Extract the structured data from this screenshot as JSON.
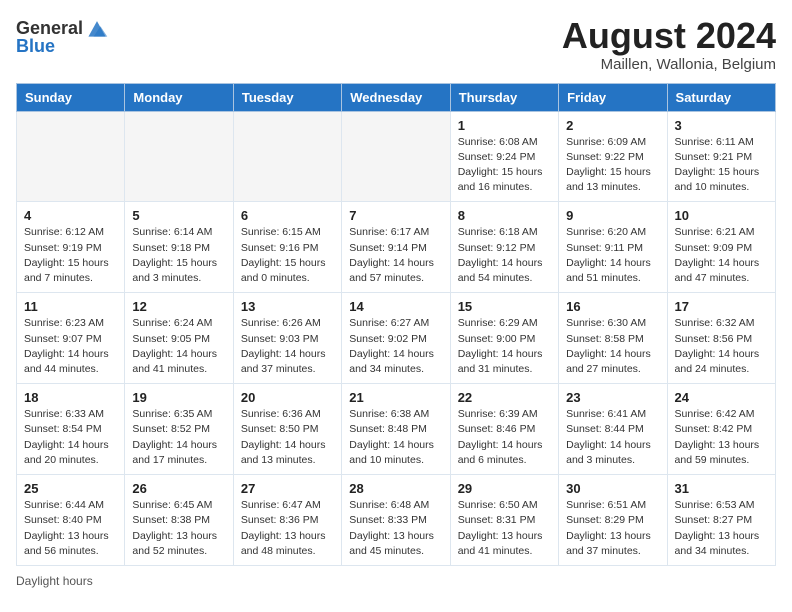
{
  "header": {
    "logo_general": "General",
    "logo_blue": "Blue",
    "month_title": "August 2024",
    "location": "Maillen, Wallonia, Belgium"
  },
  "days": [
    "Sunday",
    "Monday",
    "Tuesday",
    "Wednesday",
    "Thursday",
    "Friday",
    "Saturday"
  ],
  "weeks": [
    [
      {
        "day": "",
        "info": ""
      },
      {
        "day": "",
        "info": ""
      },
      {
        "day": "",
        "info": ""
      },
      {
        "day": "",
        "info": ""
      },
      {
        "day": "1",
        "info": "Sunrise: 6:08 AM\nSunset: 9:24 PM\nDaylight: 15 hours and 16 minutes."
      },
      {
        "day": "2",
        "info": "Sunrise: 6:09 AM\nSunset: 9:22 PM\nDaylight: 15 hours and 13 minutes."
      },
      {
        "day": "3",
        "info": "Sunrise: 6:11 AM\nSunset: 9:21 PM\nDaylight: 15 hours and 10 minutes."
      }
    ],
    [
      {
        "day": "4",
        "info": "Sunrise: 6:12 AM\nSunset: 9:19 PM\nDaylight: 15 hours and 7 minutes."
      },
      {
        "day": "5",
        "info": "Sunrise: 6:14 AM\nSunset: 9:18 PM\nDaylight: 15 hours and 3 minutes."
      },
      {
        "day": "6",
        "info": "Sunrise: 6:15 AM\nSunset: 9:16 PM\nDaylight: 15 hours and 0 minutes."
      },
      {
        "day": "7",
        "info": "Sunrise: 6:17 AM\nSunset: 9:14 PM\nDaylight: 14 hours and 57 minutes."
      },
      {
        "day": "8",
        "info": "Sunrise: 6:18 AM\nSunset: 9:12 PM\nDaylight: 14 hours and 54 minutes."
      },
      {
        "day": "9",
        "info": "Sunrise: 6:20 AM\nSunset: 9:11 PM\nDaylight: 14 hours and 51 minutes."
      },
      {
        "day": "10",
        "info": "Sunrise: 6:21 AM\nSunset: 9:09 PM\nDaylight: 14 hours and 47 minutes."
      }
    ],
    [
      {
        "day": "11",
        "info": "Sunrise: 6:23 AM\nSunset: 9:07 PM\nDaylight: 14 hours and 44 minutes."
      },
      {
        "day": "12",
        "info": "Sunrise: 6:24 AM\nSunset: 9:05 PM\nDaylight: 14 hours and 41 minutes."
      },
      {
        "day": "13",
        "info": "Sunrise: 6:26 AM\nSunset: 9:03 PM\nDaylight: 14 hours and 37 minutes."
      },
      {
        "day": "14",
        "info": "Sunrise: 6:27 AM\nSunset: 9:02 PM\nDaylight: 14 hours and 34 minutes."
      },
      {
        "day": "15",
        "info": "Sunrise: 6:29 AM\nSunset: 9:00 PM\nDaylight: 14 hours and 31 minutes."
      },
      {
        "day": "16",
        "info": "Sunrise: 6:30 AM\nSunset: 8:58 PM\nDaylight: 14 hours and 27 minutes."
      },
      {
        "day": "17",
        "info": "Sunrise: 6:32 AM\nSunset: 8:56 PM\nDaylight: 14 hours and 24 minutes."
      }
    ],
    [
      {
        "day": "18",
        "info": "Sunrise: 6:33 AM\nSunset: 8:54 PM\nDaylight: 14 hours and 20 minutes."
      },
      {
        "day": "19",
        "info": "Sunrise: 6:35 AM\nSunset: 8:52 PM\nDaylight: 14 hours and 17 minutes."
      },
      {
        "day": "20",
        "info": "Sunrise: 6:36 AM\nSunset: 8:50 PM\nDaylight: 14 hours and 13 minutes."
      },
      {
        "day": "21",
        "info": "Sunrise: 6:38 AM\nSunset: 8:48 PM\nDaylight: 14 hours and 10 minutes."
      },
      {
        "day": "22",
        "info": "Sunrise: 6:39 AM\nSunset: 8:46 PM\nDaylight: 14 hours and 6 minutes."
      },
      {
        "day": "23",
        "info": "Sunrise: 6:41 AM\nSunset: 8:44 PM\nDaylight: 14 hours and 3 minutes."
      },
      {
        "day": "24",
        "info": "Sunrise: 6:42 AM\nSunset: 8:42 PM\nDaylight: 13 hours and 59 minutes."
      }
    ],
    [
      {
        "day": "25",
        "info": "Sunrise: 6:44 AM\nSunset: 8:40 PM\nDaylight: 13 hours and 56 minutes."
      },
      {
        "day": "26",
        "info": "Sunrise: 6:45 AM\nSunset: 8:38 PM\nDaylight: 13 hours and 52 minutes."
      },
      {
        "day": "27",
        "info": "Sunrise: 6:47 AM\nSunset: 8:36 PM\nDaylight: 13 hours and 48 minutes."
      },
      {
        "day": "28",
        "info": "Sunrise: 6:48 AM\nSunset: 8:33 PM\nDaylight: 13 hours and 45 minutes."
      },
      {
        "day": "29",
        "info": "Sunrise: 6:50 AM\nSunset: 8:31 PM\nDaylight: 13 hours and 41 minutes."
      },
      {
        "day": "30",
        "info": "Sunrise: 6:51 AM\nSunset: 8:29 PM\nDaylight: 13 hours and 37 minutes."
      },
      {
        "day": "31",
        "info": "Sunrise: 6:53 AM\nSunset: 8:27 PM\nDaylight: 13 hours and 34 minutes."
      }
    ]
  ],
  "footer": {
    "daylight_label": "Daylight hours"
  }
}
